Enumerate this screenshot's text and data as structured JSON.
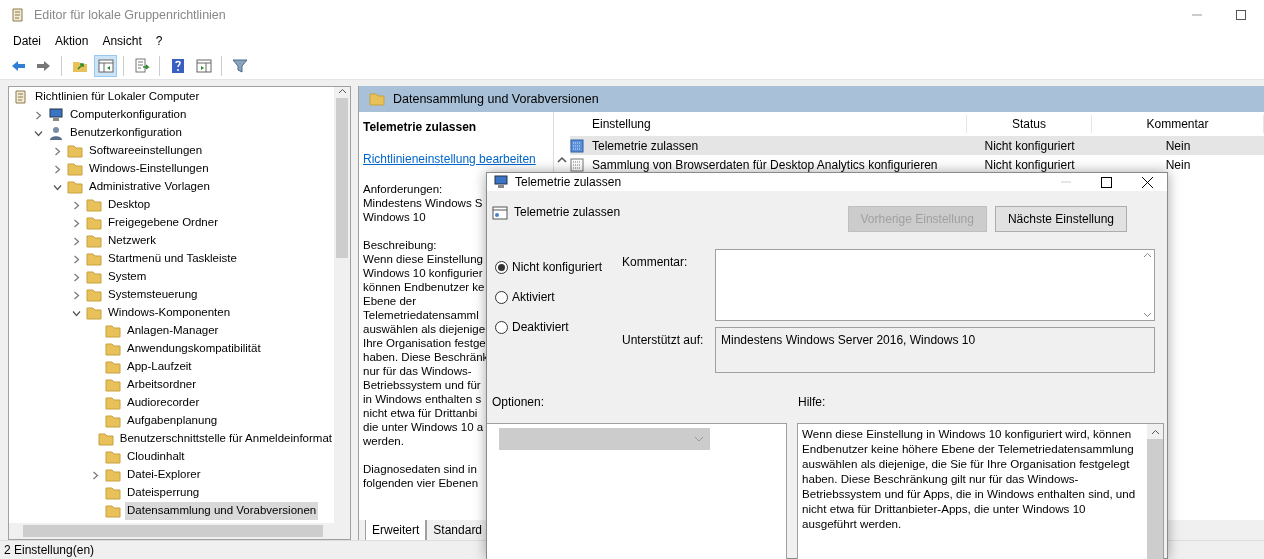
{
  "window": {
    "title": "Editor für lokale Gruppenrichtlinien"
  },
  "menu": [
    "Datei",
    "Aktion",
    "Ansicht",
    "?"
  ],
  "toolbar": [
    {
      "kind": "back",
      "pressed": false
    },
    {
      "kind": "forward",
      "pressed": false
    },
    {
      "kind": "sep"
    },
    {
      "kind": "up",
      "pressed": false
    },
    {
      "kind": "pane",
      "pressed": true
    },
    {
      "kind": "sep"
    },
    {
      "kind": "export",
      "pressed": false
    },
    {
      "kind": "sep"
    },
    {
      "kind": "help",
      "pressed": false
    },
    {
      "kind": "view",
      "pressed": false
    },
    {
      "kind": "sep"
    },
    {
      "kind": "filter",
      "pressed": false
    }
  ],
  "tree": [
    {
      "label": "Richtlinien für Lokaler Computer",
      "kind": "root",
      "selected": false,
      "children": [
        {
          "label": "Computerkonfiguration",
          "kind": "computer",
          "expanded": false,
          "selected": false
        },
        {
          "label": "Benutzerkonfiguration",
          "kind": "user",
          "expanded": true,
          "selected": false,
          "children": [
            {
              "label": "Softwareeinstellungen",
              "kind": "folder",
              "expanded": false,
              "selected": false
            },
            {
              "label": "Windows-Einstellungen",
              "kind": "folder",
              "expanded": false,
              "selected": false
            },
            {
              "label": "Administrative Vorlagen",
              "kind": "folder",
              "expanded": true,
              "selected": false,
              "children": [
                {
                  "label": "Desktop",
                  "kind": "folder",
                  "expanded": false,
                  "selected": false
                },
                {
                  "label": "Freigegebene Ordner",
                  "kind": "folder",
                  "expanded": false,
                  "selected": false
                },
                {
                  "label": "Netzwerk",
                  "kind": "folder",
                  "expanded": false,
                  "selected": false
                },
                {
                  "label": "Startmenü und Taskleiste",
                  "kind": "folder",
                  "expanded": false,
                  "selected": false
                },
                {
                  "label": "System",
                  "kind": "folder",
                  "expanded": false,
                  "selected": false
                },
                {
                  "label": "Systemsteuerung",
                  "kind": "folder",
                  "expanded": false,
                  "selected": false
                },
                {
                  "label": "Windows-Komponenten",
                  "kind": "folder",
                  "expanded": true,
                  "selected": false,
                  "children": [
                    {
                      "label": "Anlagen-Manager",
                      "kind": "folder",
                      "selected": false
                    },
                    {
                      "label": "Anwendungskompatibilität",
                      "kind": "folder",
                      "selected": false
                    },
                    {
                      "label": "App-Laufzeit",
                      "kind": "folder",
                      "selected": false
                    },
                    {
                      "label": "Arbeitsordner",
                      "kind": "folder",
                      "selected": false
                    },
                    {
                      "label": "Audiorecorder",
                      "kind": "folder",
                      "selected": false
                    },
                    {
                      "label": "Aufgabenplanung",
                      "kind": "folder",
                      "selected": false
                    },
                    {
                      "label": "Benutzerschnittstelle für Anmeldeinformat",
                      "kind": "folder",
                      "selected": false
                    },
                    {
                      "label": "Cloudinhalt",
                      "kind": "folder",
                      "selected": false
                    },
                    {
                      "label": "Datei-Explorer",
                      "kind": "folder",
                      "expanded": false,
                      "selected": false
                    },
                    {
                      "label": "Dateisperrung",
                      "kind": "folder",
                      "selected": false
                    },
                    {
                      "label": "Datensammlung und Vorabversionen",
                      "kind": "folder",
                      "selected": true
                    }
                  ]
                }
              ]
            }
          ]
        }
      ]
    }
  ],
  "header": {
    "title": "Datensammlung und Vorabversionen"
  },
  "description": {
    "title": "Telemetrie zulassen",
    "link": "Richtlinieneinstellung bearbeiten",
    "paragraphs": [
      [
        "Anforderungen:",
        "Mindestens Windows S",
        "Windows 10"
      ],
      [
        "Beschreibung:",
        "Wenn diese Einstellung",
        "Windows 10 konfigurier",
        "können Endbenutzer ke",
        "Ebene der",
        "Telemetriedatensamml",
        "auswählen als diejenige",
        "Ihre Organisation festge",
        "haben. Diese Beschränk",
        "nur für das Windows-",
        "Betriebssystem und für",
        "in Windows enthalten s",
        "nicht etwa für Drittanbi",
        "die unter Windows 10 a",
        "werden."
      ],
      [
        "Diagnosedaten sind in",
        "folgenden vier Ebenen"
      ]
    ]
  },
  "tabs": [
    {
      "label": "Erweitert",
      "selected": true
    },
    {
      "label": "Standard",
      "selected": false
    }
  ],
  "table": {
    "columns": [
      "Einstellung",
      "Status",
      "Kommentar"
    ],
    "rows": [
      {
        "kind": "policy-selected",
        "cells": [
          "Telemetrie zulassen",
          "Nicht konfiguriert",
          "Nein"
        ],
        "selected": true
      },
      {
        "kind": "policy",
        "cells": [
          "Sammlung von Browserdaten für Desktop Analytics konfigurieren",
          "Nicht konfiguriert",
          "Nein"
        ],
        "selected": false
      }
    ]
  },
  "dialog": {
    "title": "Telemetrie zulassen",
    "setting": "Telemetrie zulassen",
    "buttons": [
      {
        "label": "Vorherige Einstellung",
        "disabled": true
      },
      {
        "label": "Nächste Einstellung",
        "disabled": false
      }
    ],
    "options": [
      {
        "label": "Nicht konfiguriert",
        "selected": true
      },
      {
        "label": "Aktiviert",
        "selected": false
      },
      {
        "label": "Deaktiviert",
        "selected": false
      }
    ],
    "comment_label": "Kommentar:",
    "supported_label": "Unterstützt auf:",
    "supported": "Mindestens Windows Server 2016, Windows 10",
    "options_label": "Optionen:",
    "help_label": "Hilfe:",
    "help": "Wenn diese Einstellung in Windows 10 konfiguriert wird, können Endbenutzer keine höhere Ebene der Telemetriedatensammlung auswählen als diejenige, die Sie für Ihre Organisation festgelegt haben. Diese Beschränkung gilt nur für das Windows-Betriebssystem und für Apps, die in Windows enthalten sind, und nicht etwa für Drittanbieter-Apps, die unter Windows 10 ausgeführt werden."
  },
  "status_bar": "2 Einstellung(en)"
}
